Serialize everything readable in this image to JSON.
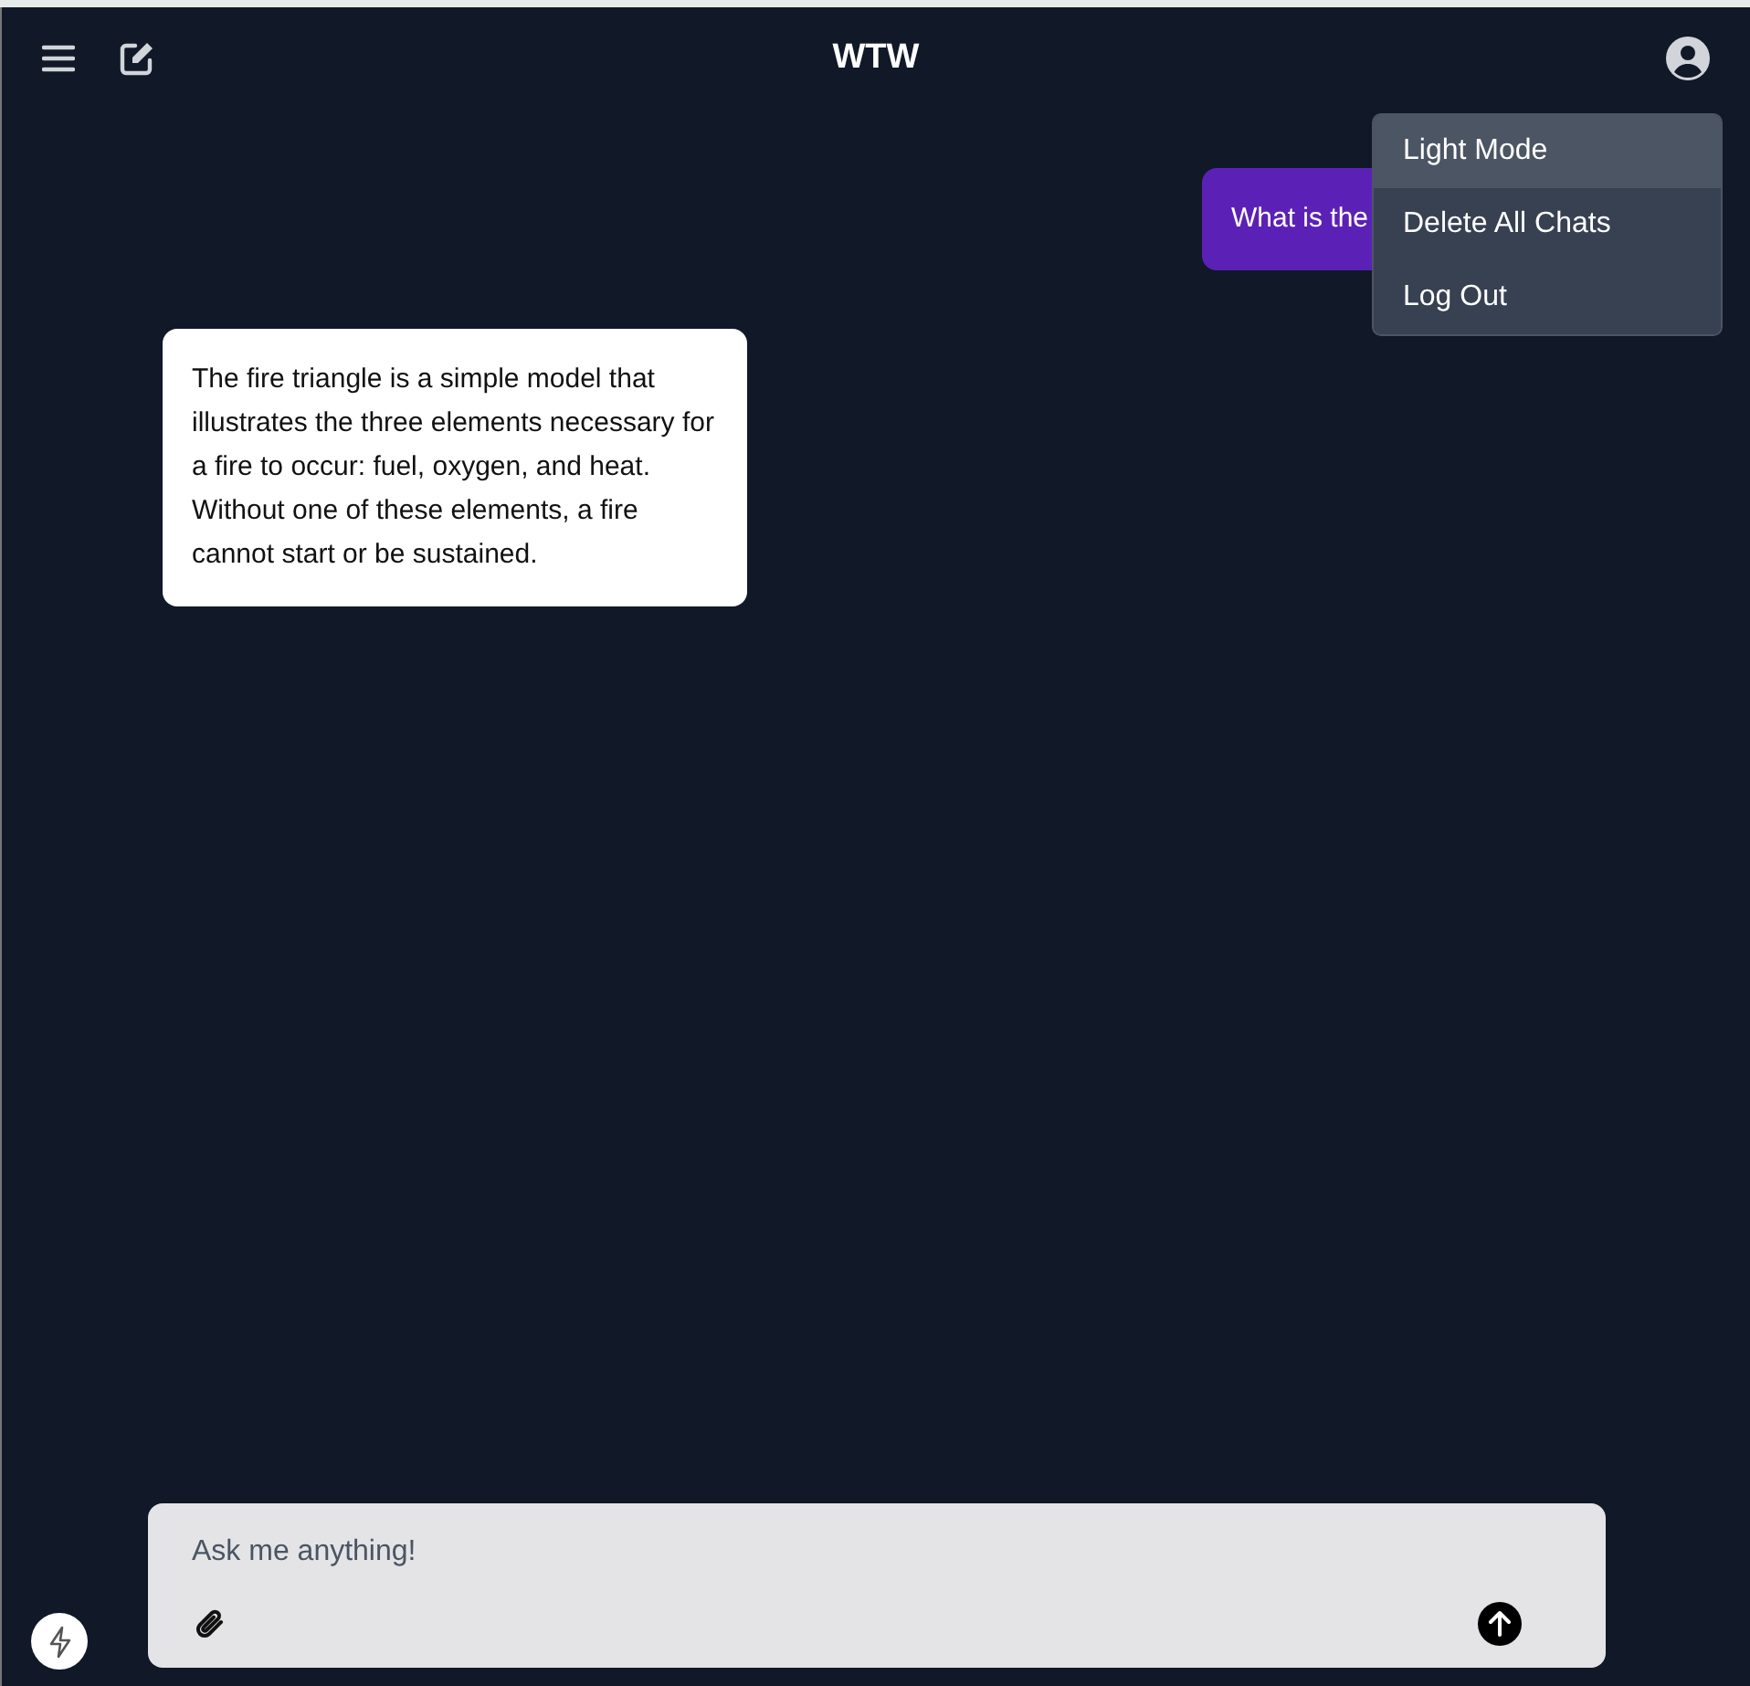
{
  "header": {
    "title": "WTW"
  },
  "menu": {
    "items": [
      {
        "label": "Light Mode",
        "selected": true
      },
      {
        "label": "Delete All Chats",
        "selected": false
      },
      {
        "label": "Log Out",
        "selected": false
      }
    ]
  },
  "messages": [
    {
      "kind": "user",
      "text": "What is the"
    },
    {
      "kind": "assistant",
      "text": "The fire triangle is a simple model that illustrates the three elements necessary for a fire to occur: fuel, oxygen, and heat. Without one of these elements, a fire cannot start or be sustained."
    }
  ],
  "composer": {
    "placeholder": "Ask me anything!"
  }
}
